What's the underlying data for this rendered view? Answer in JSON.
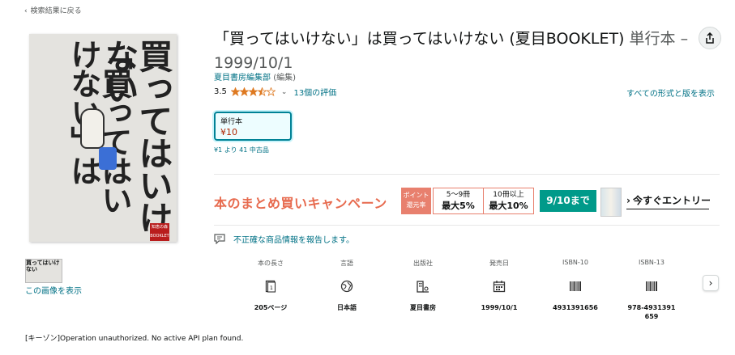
{
  "nav": {
    "back_label": "検索結果に戻る"
  },
  "cover": {
    "title_col1": "買ってはいけない",
    "title_col2": "「買ってはいけない」は",
    "badge": "知恵の森BOOKLET"
  },
  "thumbnail": {
    "text": "買ってはいけない",
    "view_link": "この画像を表示"
  },
  "product": {
    "title": "「買ってはいけない」は買ってはいけない (夏目BOOKLET)",
    "binding_meta": "単行本 – 1999/10/1",
    "author": "夏目書房編集部",
    "author_role": "(編集)",
    "rating_value": "3.5",
    "stars": 3.5,
    "rating_count": "13個の評価",
    "all_formats": "すべての形式と版を表示"
  },
  "format": {
    "name": "単行本",
    "price": "¥10",
    "used_offers": "¥1 より 41 中古品"
  },
  "banner": {
    "headline": "本のまとめ買いキャンペーン",
    "points_label_1": "ポイント",
    "points_label_2": "還元率",
    "tier1_qty": "5〜9冊",
    "tier1_rate": "最大5%",
    "tier2_qty": "10冊以上",
    "tier2_rate": "最大10%",
    "deadline": "9/10まで",
    "entry_label": "今すぐエントリー",
    "accent_color": "#e76a4e",
    "deadline_color": "#009a8a"
  },
  "report_link": "不正確な商品情報を報告します。",
  "details": [
    {
      "label": "本の長さ",
      "icon": "pages-icon",
      "value": "205ページ"
    },
    {
      "label": "言語",
      "icon": "globe-icon",
      "value": "日本語"
    },
    {
      "label": "出版社",
      "icon": "building-icon",
      "value": "夏目書房"
    },
    {
      "label": "発売日",
      "icon": "calendar-icon",
      "value": "1999/10/1"
    },
    {
      "label": "ISBN-10",
      "icon": "barcode-icon",
      "value": "4931391656"
    },
    {
      "label": "ISBN-13",
      "icon": "barcode-icon",
      "value": "978-4931391659"
    }
  ],
  "footer_message": "[キーゾン]Operation unauthorized. No active API plan found."
}
